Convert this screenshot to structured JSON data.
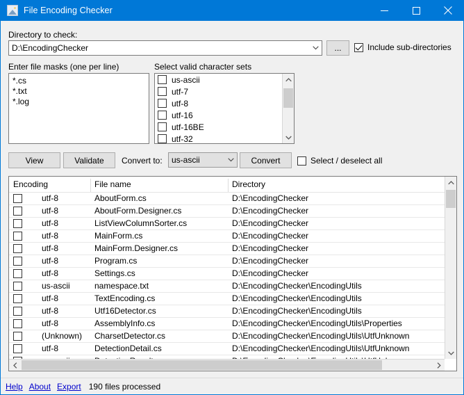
{
  "window": {
    "title": "File Encoding Checker",
    "icon": "picture-icon",
    "accent_color": "#0078d7",
    "minimize_label": "Minimize",
    "maximize_label": "Maximize",
    "close_label": "Close"
  },
  "directory": {
    "label": "Directory to check:",
    "value": "D:\\EncodingChecker",
    "placeholder": "",
    "browse_label": "...",
    "include_subdirs": {
      "label": "Include sub-directories",
      "checked": true
    }
  },
  "masks": {
    "label": "Enter file masks (one per line)",
    "value": "*.cs\n*.txt\n*.log",
    "lines": [
      "*.cs",
      "*.txt",
      "*.log"
    ]
  },
  "charsets": {
    "label": "Select valid character sets",
    "items": [
      {
        "label": "us-ascii",
        "checked": false
      },
      {
        "label": "utf-7",
        "checked": false
      },
      {
        "label": "utf-8",
        "checked": false
      },
      {
        "label": "utf-16",
        "checked": false
      },
      {
        "label": "utf-16BE",
        "checked": false
      },
      {
        "label": "utf-32",
        "checked": false
      }
    ]
  },
  "toolbar": {
    "view_label": "View",
    "validate_label": "Validate",
    "convert_to_label": "Convert to:",
    "convert_to_value": "us-ascii",
    "convert_label": "Convert",
    "select_all": {
      "label": "Select / deselect all",
      "checked": false
    }
  },
  "table": {
    "columns": [
      "Encoding",
      "File name",
      "Directory"
    ],
    "rows": [
      {
        "checked": false,
        "encoding": "utf-8",
        "file": "AboutForm.cs",
        "dir": "D:\\EncodingChecker"
      },
      {
        "checked": false,
        "encoding": "utf-8",
        "file": "AboutForm.Designer.cs",
        "dir": "D:\\EncodingChecker"
      },
      {
        "checked": false,
        "encoding": "utf-8",
        "file": "ListViewColumnSorter.cs",
        "dir": "D:\\EncodingChecker"
      },
      {
        "checked": false,
        "encoding": "utf-8",
        "file": "MainForm.cs",
        "dir": "D:\\EncodingChecker"
      },
      {
        "checked": false,
        "encoding": "utf-8",
        "file": "MainForm.Designer.cs",
        "dir": "D:\\EncodingChecker"
      },
      {
        "checked": false,
        "encoding": "utf-8",
        "file": "Program.cs",
        "dir": "D:\\EncodingChecker"
      },
      {
        "checked": false,
        "encoding": "utf-8",
        "file": "Settings.cs",
        "dir": "D:\\EncodingChecker"
      },
      {
        "checked": false,
        "encoding": "us-ascii",
        "file": "namespace.txt",
        "dir": "D:\\EncodingChecker\\EncodingUtils"
      },
      {
        "checked": false,
        "encoding": "utf-8",
        "file": "TextEncoding.cs",
        "dir": "D:\\EncodingChecker\\EncodingUtils"
      },
      {
        "checked": false,
        "encoding": "utf-8",
        "file": "Utf16Detector.cs",
        "dir": "D:\\EncodingChecker\\EncodingUtils"
      },
      {
        "checked": false,
        "encoding": "utf-8",
        "file": "AssemblyInfo.cs",
        "dir": "D:\\EncodingChecker\\EncodingUtils\\Properties"
      },
      {
        "checked": false,
        "encoding": "(Unknown)",
        "file": "CharsetDetector.cs",
        "dir": "D:\\EncodingChecker\\EncodingUtils\\UtfUnknown"
      },
      {
        "checked": false,
        "encoding": "utf-8",
        "file": "DetectionDetail.cs",
        "dir": "D:\\EncodingChecker\\EncodingUtils\\UtfUnknown"
      },
      {
        "checked": false,
        "encoding": "us-ascii",
        "file": "DetectionResult.cs",
        "dir": "D:\\EncodingChecker\\EncodingUtils\\UtfUnknown"
      }
    ]
  },
  "statusbar": {
    "help_label": "Help",
    "about_label": "About",
    "export_label": "Export",
    "status": "190 files processed",
    "link_color": "#0000cc"
  }
}
